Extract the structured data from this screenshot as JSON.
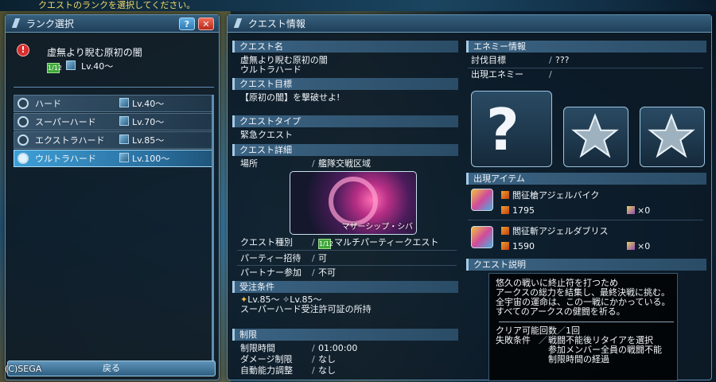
{
  "top_instruction": "クエストのランクを選択してください。",
  "rank_panel": {
    "title": "ランク選択",
    "help_label": "?",
    "close_label": "✕",
    "selected_quest": {
      "alert_icon": "exclamation-icon",
      "name": "虚無より睨む原初の闇",
      "lv_badge": "1/12",
      "lv": "Lv.40～"
    },
    "ranks": [
      {
        "name": "ハード",
        "lv": "Lv.40～"
      },
      {
        "name": "スーパーハード",
        "lv": "Lv.70～"
      },
      {
        "name": "エクストラハード",
        "lv": "Lv.85～"
      },
      {
        "name": "ウルトラハード",
        "lv": "Lv.100～"
      }
    ],
    "selected_index": 3,
    "back_label": "戻る"
  },
  "copyright": "(C)SEGA",
  "quest_panel": {
    "title": "クエスト情報",
    "quest_name_head": "クエスト名",
    "quest_name": "虚無より睨む原初の闇",
    "quest_rank": "ウルトラハード",
    "objective_head": "クエスト目標",
    "objective": "【原初の闇】を撃破せよ!",
    "type_head": "クエストタイプ",
    "type": "緊急クエスト",
    "detail_head": "クエスト詳細",
    "location_label": "場所",
    "location": "艦隊交戦区域",
    "location_image_caption": "マザーシップ・シバ",
    "category_label": "クエスト種別",
    "category_badge": "1/12",
    "category": "マルチパーティークエスト",
    "party_invite_label": "パーティー招待",
    "party_invite": "可",
    "partner_label": "パートナー参加",
    "partner": "不可",
    "conditions_head": "受注条件",
    "cond_lv_main": "Lv.85～",
    "cond_lv_sub": "Lv.85～",
    "cond_permit": "スーパーハード受注許可証の所持",
    "limits_head": "制限",
    "time_limit_label": "制限時間",
    "time_limit": "01:00:00",
    "damage_limit_label": "ダメージ制限",
    "damage_limit": "なし",
    "auto_adjust_label": "自動能力調整",
    "auto_adjust": "なし",
    "enemy_head": "エネミー情報",
    "target_label": "討伐目標",
    "target": "???",
    "appear_enemy_label": "出現エネミー",
    "enemy_unknown": "?",
    "items_head": "出現アイテム",
    "items": [
      {
        "name": "閻征槍アジェルバイク",
        "value": "1795",
        "count": "×0"
      },
      {
        "name": "閻征斬アジェルダブリス",
        "value": "1590",
        "count": "×0"
      }
    ],
    "description_head": "クエスト説明",
    "description": [
      "悠久の戦いに終止符を打つため",
      "アークスの総力を結集し、最終決戦に挑む。",
      "全宇宙の運命は、この一戦にかかっている。",
      "すべてのアークスの健闘を祈る。"
    ],
    "clear_count_label": "クリア可能回数",
    "clear_count": "1回",
    "fail_label": "失敗条件",
    "fail_conditions": [
      "戦闘不能後リタイアを選択",
      "参加メンバー全員の戦闘不能",
      "制限時間の経過"
    ]
  },
  "colors": {
    "accent": "#3d9fd6",
    "panel_border": "#5f8fb0",
    "instruction": "#f3d86a"
  }
}
